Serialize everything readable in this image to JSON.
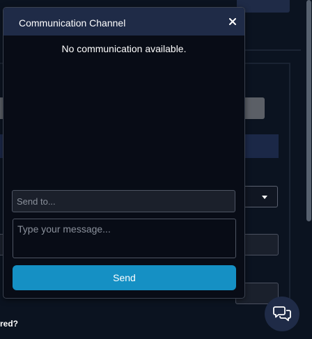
{
  "modal": {
    "title": "Communication Channel",
    "close_label": "×",
    "empty_message": "No communication available.",
    "send_to_placeholder": "Send to...",
    "message_placeholder": "Type your message...",
    "send_label": "Send"
  },
  "background": {
    "question_text": "red?"
  },
  "chat_fab": {
    "icon": "chat-bubbles-icon"
  },
  "colors": {
    "page_background": "#0b1320",
    "header_background": "#1f2b47",
    "accent_button": "#1590c4"
  }
}
